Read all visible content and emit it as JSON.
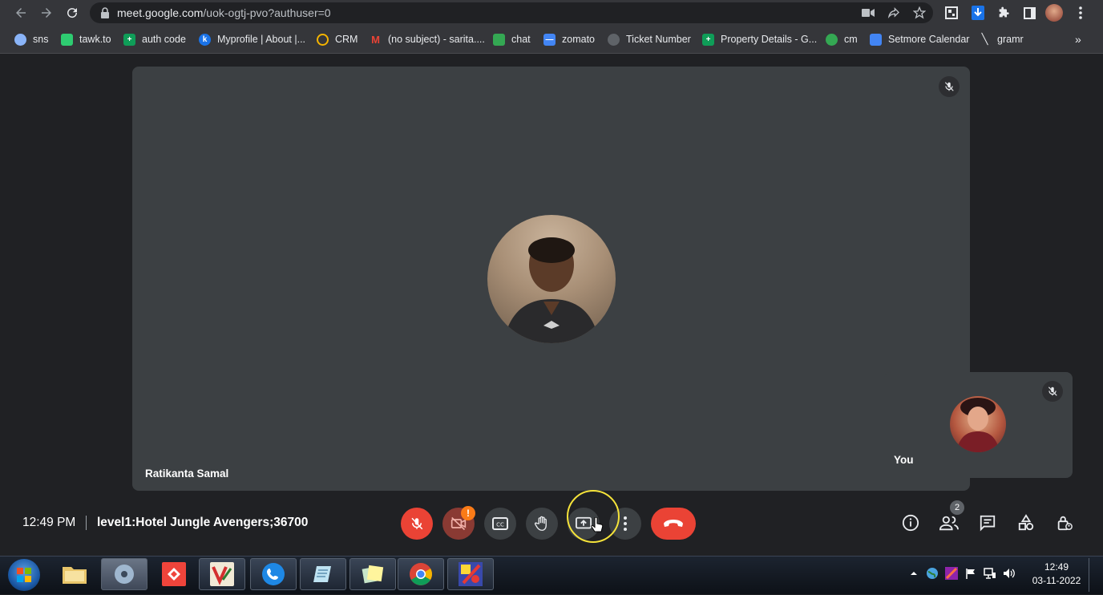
{
  "browser": {
    "url_host": "meet.google.com",
    "url_path": "/uok-ogtj-pvo?authuser=0",
    "bookmarks": [
      {
        "label": "sns",
        "icon": "sns-icon",
        "color": "#8ab4f8"
      },
      {
        "label": "tawk.to",
        "icon": "tawk-icon",
        "color": "#2ecc71"
      },
      {
        "label": "auth code",
        "icon": "sheets-icon",
        "color": "#0f9d58"
      },
      {
        "label": "Myprofile | About |...",
        "icon": "k-icon",
        "color": "#1a73e8"
      },
      {
        "label": "CRM",
        "icon": "crm-icon",
        "color": "#f4b400"
      },
      {
        "label": "(no subject) - sarita....",
        "icon": "gmail-icon",
        "color": "#ea4335"
      },
      {
        "label": "chat",
        "icon": "chat-icon",
        "color": "#34a853"
      },
      {
        "label": "zomato",
        "icon": "zomato-icon",
        "color": "#4285f4"
      },
      {
        "label": "Ticket Number",
        "icon": "globe-icon",
        "color": "#9aa0a6"
      },
      {
        "label": "Property Details - G...",
        "icon": "sheets-icon",
        "color": "#0f9d58"
      },
      {
        "label": "cm",
        "icon": "cm-icon",
        "color": "#34a853"
      },
      {
        "label": "Setmore Calendar",
        "icon": "setmore-icon",
        "color": "#4285f4"
      },
      {
        "label": "gramr",
        "icon": "pen-icon",
        "color": "#e8eaed"
      }
    ],
    "more_bookmarks": "»"
  },
  "meet": {
    "main_participant": "Ratikanta Samal",
    "self_label": "You",
    "clock": "12:49 PM",
    "meeting_code": "level1:Hotel Jungle Avengers;36700",
    "camera_warning": "!",
    "people_count": "2",
    "colors": {
      "danger": "#ea4335",
      "warning": "#fa7b17",
      "highlight": "#f5e33a",
      "tile": "#3c4043"
    }
  },
  "taskbar": {
    "time": "12:49",
    "date": "03-11-2022"
  }
}
